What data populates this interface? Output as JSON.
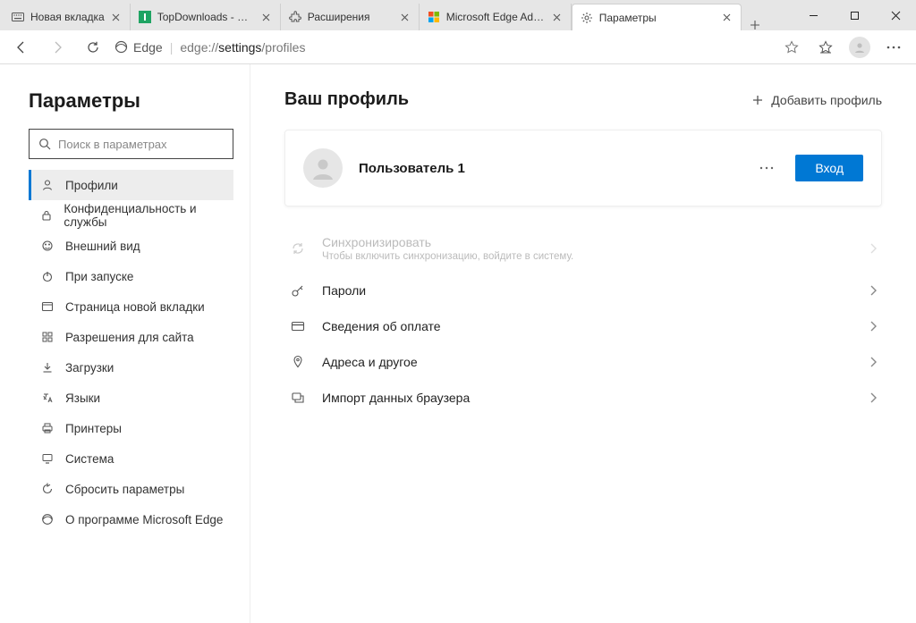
{
  "window": {
    "tabs": [
      {
        "title": "Новая вкладка",
        "icon": "keyboard"
      },
      {
        "title": "TopDownloads - Самые п",
        "icon": "green-square"
      },
      {
        "title": "Расширения",
        "icon": "puzzle"
      },
      {
        "title": "Microsoft Edge Addons",
        "icon": "ms-logo"
      },
      {
        "title": "Параметры",
        "icon": "gear",
        "active": true
      }
    ],
    "newtab_label": "+"
  },
  "toolbar": {
    "edge_label": "Edge",
    "url_prefix": "edge://",
    "url_strong": "settings",
    "url_suffix": "/profiles"
  },
  "sidebar": {
    "title": "Параметры",
    "search_placeholder": "Поиск в параметрах",
    "items": [
      {
        "label": "Профили",
        "icon": "person",
        "active": true
      },
      {
        "label": "Конфиденциальность и службы",
        "icon": "lock"
      },
      {
        "label": "Внешний вид",
        "icon": "appearance"
      },
      {
        "label": "При запуске",
        "icon": "power"
      },
      {
        "label": "Страница новой вкладки",
        "icon": "newtab"
      },
      {
        "label": "Разрешения для сайта",
        "icon": "permissions"
      },
      {
        "label": "Загрузки",
        "icon": "download"
      },
      {
        "label": "Языки",
        "icon": "languages"
      },
      {
        "label": "Принтеры",
        "icon": "printer"
      },
      {
        "label": "Система",
        "icon": "system"
      },
      {
        "label": "Сбросить параметры",
        "icon": "reset"
      },
      {
        "label": "О программе Microsoft Edge",
        "icon": "edge"
      }
    ]
  },
  "main": {
    "title": "Ваш профиль",
    "add_profile_label": "Добавить профиль",
    "profile": {
      "name": "Пользователь 1",
      "signin_label": "Вход"
    },
    "rows": [
      {
        "label": "Синхронизировать",
        "sub": "Чтобы включить синхронизацию, войдите в систему.",
        "icon": "sync",
        "disabled": true
      },
      {
        "label": "Пароли",
        "icon": "key"
      },
      {
        "label": "Сведения об оплате",
        "icon": "card"
      },
      {
        "label": "Адреса и другое",
        "icon": "pin"
      },
      {
        "label": "Импорт данных браузера",
        "icon": "import"
      }
    ]
  }
}
